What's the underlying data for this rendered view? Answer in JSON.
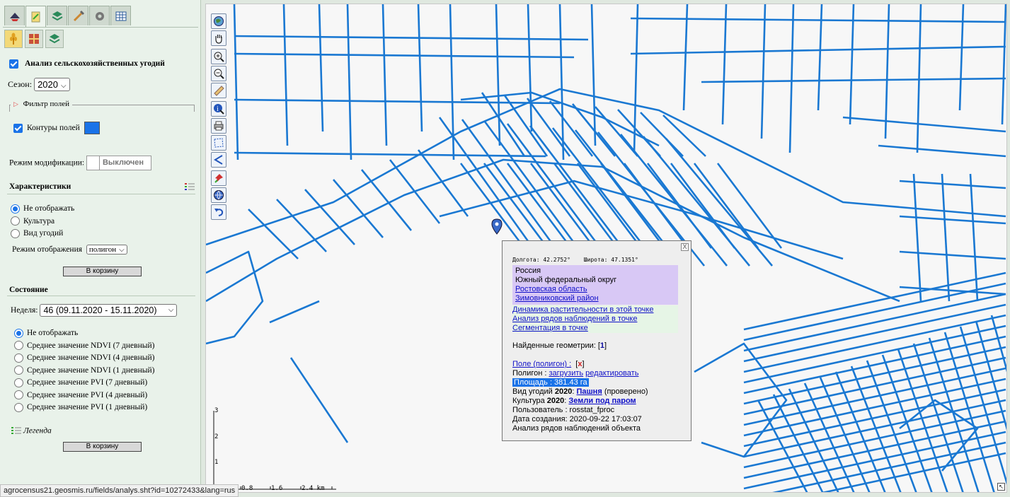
{
  "panel": {
    "tabs": [
      "layers-tab",
      "analysis-tab",
      "stack-tab",
      "tools-tab",
      "settings-tab",
      "table-tab"
    ],
    "subtabs": [
      "crop-subtab",
      "fields-subtab",
      "layers-subtab"
    ],
    "analysis_title": "Анализ сельскохозяйственных угодий",
    "season_label": "Сезон:",
    "season_value": "2020",
    "filter_label": "Фильтр полей",
    "contours_label": "Контуры полей",
    "contour_color": "#1a73e8",
    "mode_label": "Режим модификации:",
    "mode_value": "Выключен",
    "characteristics_title": "Характеристики",
    "char_options": [
      "Не отображать",
      "Культура",
      "Вид угодий"
    ],
    "display_mode_label": "Режим отображения",
    "display_mode_value": "полигон",
    "basket_label": "В корзину",
    "state_title": "Состояние",
    "week_label": "Неделя:",
    "week_value": "46 (09.11.2020 - 15.11.2020)",
    "state_options": [
      "Не отображать",
      "Среднее значение NDVI (7 дневный)",
      "Среднее значение NDVI (4 дневный)",
      "Среднее значение NDVI (1 дневный)",
      "Среднее значение PVI (7 дневный)",
      "Среднее значение PVI (4 дневный)",
      "Среднее значение PVI (1 дневный)"
    ],
    "legend_label": "Легенда",
    "basket_label2": "В корзину"
  },
  "map": {
    "tools": [
      "globe-icon",
      "pan-hand-icon",
      "zoom-in-icon",
      "zoom-out-icon",
      "ruler-icon",
      "info-icon",
      "print-icon",
      "select-polygon-icon",
      "measure-angle-icon",
      "pin-icon",
      "layers-globe-icon",
      "undo-icon"
    ],
    "scale_labels": [
      "0.8",
      "1.6",
      "2.4 km"
    ],
    "vscale_labels": [
      "3",
      "2",
      "1"
    ],
    "field_color": "#1a78d2"
  },
  "popup": {
    "close": "X",
    "lon_label": "Долгота: 42.2752°",
    "lat_label": "Широта: 47.1351°",
    "country": "Россия",
    "district": "Южный федеральный округ",
    "region": "Ростовская область",
    "raion": "Зимовниковский район",
    "links": [
      "Динамика растительности в этой точке",
      "Анализ рядов наблюдений в точке",
      "Сегментация в точке"
    ],
    "found_label": "Найденные геометрии:",
    "found_count": "1",
    "field_link": "Поле (полигон) :",
    "remove": "x",
    "polygon_label": "Полигон :",
    "load": "загрузить",
    "edit": "редактировать",
    "area": "Площадь : 381.43 га",
    "landuse_prefix": "Вид угодий",
    "year": "2020",
    "landuse_value": "Пашня",
    "landuse_note": "(проверено)",
    "crop_prefix": "Культура",
    "crop_value": "Земли под паром",
    "user": "Пользователь : rosstat_fproc",
    "created": "Дата создания: 2020-09-22 17:03:07",
    "series": "Анализ рядов наблюдений объекта"
  },
  "status_url": "agrocensus21.geosmis.ru/fields/analys.sht?id=10272433&lang=rus"
}
